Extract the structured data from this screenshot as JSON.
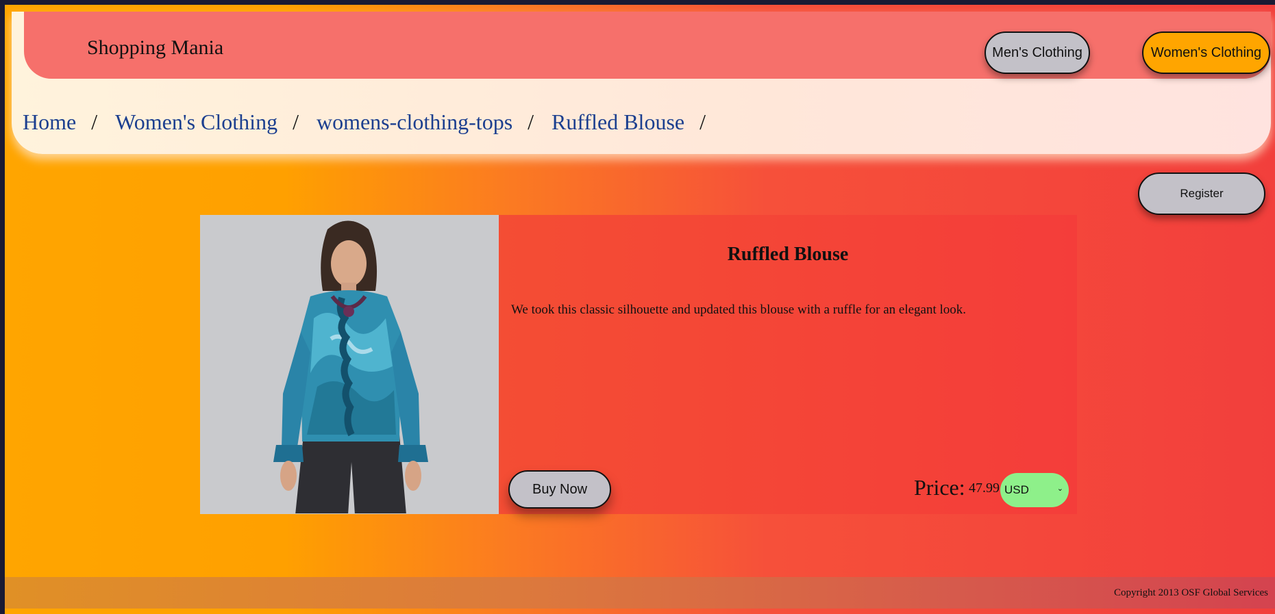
{
  "header": {
    "brand": "Shopping Mania",
    "nav": {
      "mens": "Men's Clothing",
      "womens": "Women's Clothing"
    }
  },
  "breadcrumb": [
    {
      "label": "Home"
    },
    {
      "label": "Women's Clothing"
    },
    {
      "label": "womens-clothing-tops"
    },
    {
      "label": "Ruffled Blouse"
    }
  ],
  "breadcrumb_separator": "/",
  "register_label": "Register",
  "product": {
    "title": "Ruffled Blouse",
    "description": "We took this classic silhouette and updated this blouse with a ruffle for an elegant look.",
    "buy_label": "Buy Now",
    "price_label": "Price:",
    "price": "47.99",
    "currency": "USD"
  },
  "footer": {
    "copyright": "Copyright 2013 OSF Global Services"
  },
  "colors": {
    "top_bar": "#f6706b",
    "womens_active": "#ffa500",
    "button_gray": "#c3c1c8",
    "currency_bg": "#8ef08a",
    "link": "#1c3f8f"
  }
}
